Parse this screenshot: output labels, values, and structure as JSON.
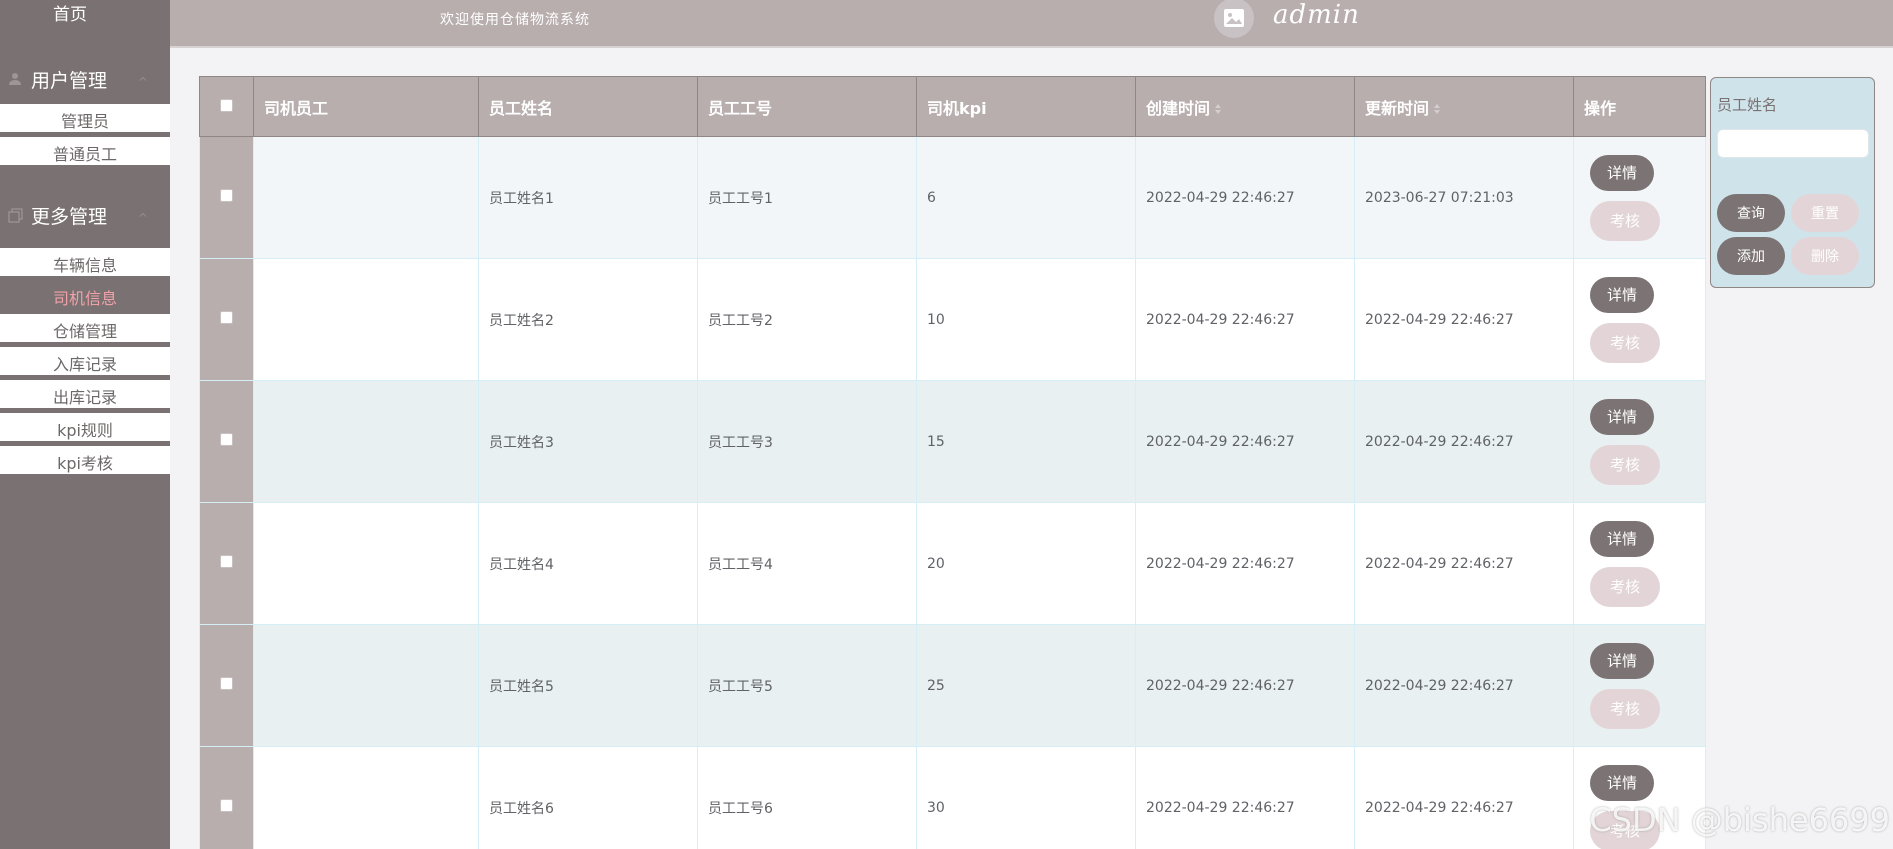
{
  "sidebar": {
    "home": "首页",
    "groups": [
      {
        "label": "用户管理",
        "items": [
          "管理员",
          "普通员工"
        ]
      },
      {
        "label": "更多管理",
        "items": [
          "车辆信息",
          "司机信息",
          "仓储管理",
          "入库记录",
          "出库记录",
          "kpi规则",
          "kpi考核"
        ]
      }
    ],
    "active_item": "司机信息"
  },
  "topbar": {
    "welcome": "欢迎使用仓储物流系统",
    "username": "admin"
  },
  "table": {
    "headers": [
      "司机员工",
      "员工姓名",
      "员工工号",
      "司机kpi",
      "创建时间",
      "更新时间",
      "操作"
    ],
    "rows": [
      {
        "name": "员工姓名1",
        "no": "员工工号1",
        "kpi": "6",
        "created": "2022-04-29 22:46:27",
        "updated": "2023-06-27 07:21:03"
      },
      {
        "name": "员工姓名2",
        "no": "员工工号2",
        "kpi": "10",
        "created": "2022-04-29 22:46:27",
        "updated": "2022-04-29 22:46:27"
      },
      {
        "name": "员工姓名3",
        "no": "员工工号3",
        "kpi": "15",
        "created": "2022-04-29 22:46:27",
        "updated": "2022-04-29 22:46:27"
      },
      {
        "name": "员工姓名4",
        "no": "员工工号4",
        "kpi": "20",
        "created": "2022-04-29 22:46:27",
        "updated": "2022-04-29 22:46:27"
      },
      {
        "name": "员工姓名5",
        "no": "员工工号5",
        "kpi": "25",
        "created": "2022-04-29 22:46:27",
        "updated": "2022-04-29 22:46:27"
      },
      {
        "name": "员工姓名6",
        "no": "员工工号6",
        "kpi": "30",
        "created": "2022-04-29 22:46:27",
        "updated": "2022-04-29 22:46:27"
      }
    ],
    "detail_label": "详情",
    "audit_label": "考核"
  },
  "search": {
    "label": "员工姓名",
    "query": "查询",
    "reset": "重置",
    "add": "添加",
    "delete": "删除"
  },
  "watermark": "CSDN @bishe6699",
  "colors": {
    "sidebar_bg": "#7a7272",
    "header_bg": "#b8aeae",
    "active_text": "#f2a1a9",
    "primary_button": "#7c7474",
    "secondary_button": "#e3d5d7",
    "search_panel_bg": "#cfe3ea"
  }
}
